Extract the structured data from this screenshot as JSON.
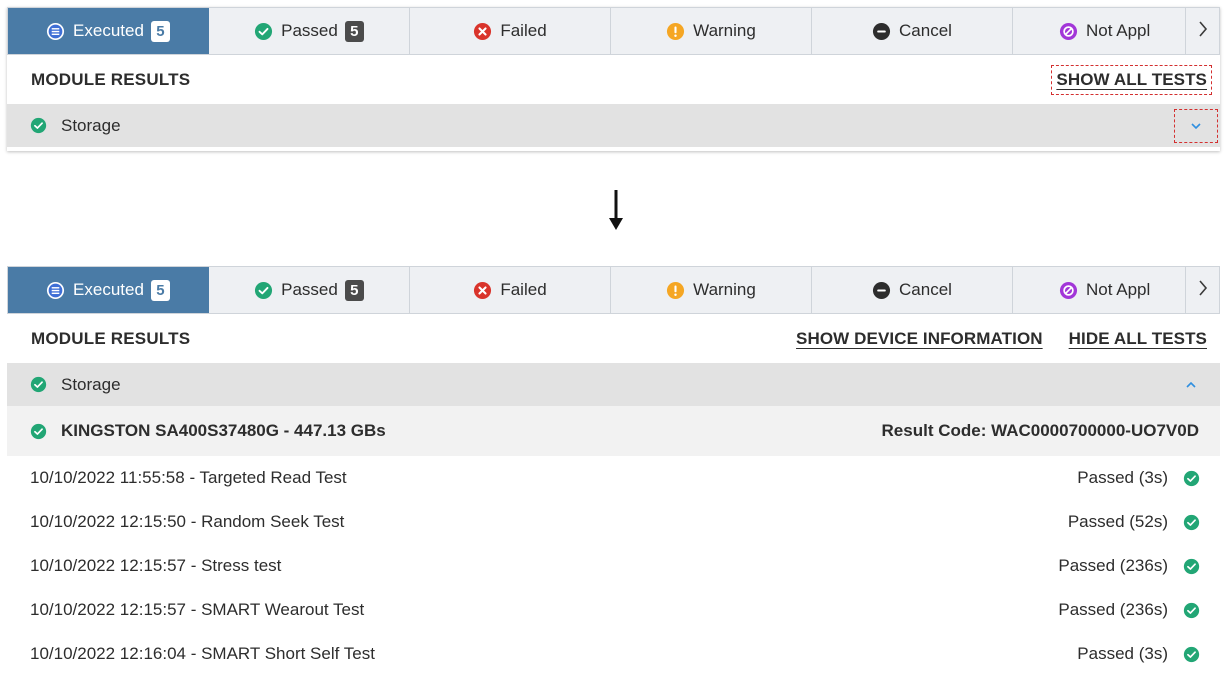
{
  "tabs": [
    {
      "label": "Executed",
      "count": "5",
      "icon": "list-icon",
      "active": true
    },
    {
      "label": "Passed",
      "count": "5",
      "icon": "check-circle-icon",
      "active": false
    },
    {
      "label": "Failed",
      "icon": "x-circle-icon",
      "active": false
    },
    {
      "label": "Warning",
      "icon": "exclamation-circle-icon",
      "active": false
    },
    {
      "label": "Cancel",
      "icon": "minus-circle-icon",
      "active": false
    },
    {
      "label": "Not Appl",
      "icon": "ban-circle-icon",
      "active": false
    }
  ],
  "before": {
    "section_title": "MODULE RESULTS",
    "show_all_tests": "SHOW ALL TESTS",
    "group_label": "Storage"
  },
  "after": {
    "section_title": "MODULE RESULTS",
    "show_device_info": "SHOW DEVICE INFORMATION",
    "hide_all_tests": "HIDE ALL TESTS",
    "group_label": "Storage",
    "device_name": "KINGSTON SA400S37480G - 447.13 GBs",
    "result_code": "Result Code: WAC0000700000-UO7V0D",
    "tests": [
      {
        "name": "10/10/2022 11:55:58 - Targeted Read Test",
        "status": "Passed (3s)"
      },
      {
        "name": "10/10/2022 12:15:50 - Random Seek Test",
        "status": "Passed (52s)"
      },
      {
        "name": "10/10/2022 12:15:57 - Stress test",
        "status": "Passed (236s)"
      },
      {
        "name": "10/10/2022 12:15:57 - SMART Wearout Test",
        "status": "Passed (236s)"
      },
      {
        "name": "10/10/2022 12:16:04 - SMART Short Self Test",
        "status": "Passed (3s)"
      }
    ]
  },
  "colors": {
    "active_tab": "#4a7ba6",
    "pass_green": "#22a675",
    "fail_red": "#d9342b",
    "warning_orange": "#f5a623",
    "cancel_dark": "#2d2d2d",
    "not_applicable_purple": "#a236d8",
    "chevron_blue": "#2f8fe0",
    "annotation_red": "#d32f2f"
  }
}
